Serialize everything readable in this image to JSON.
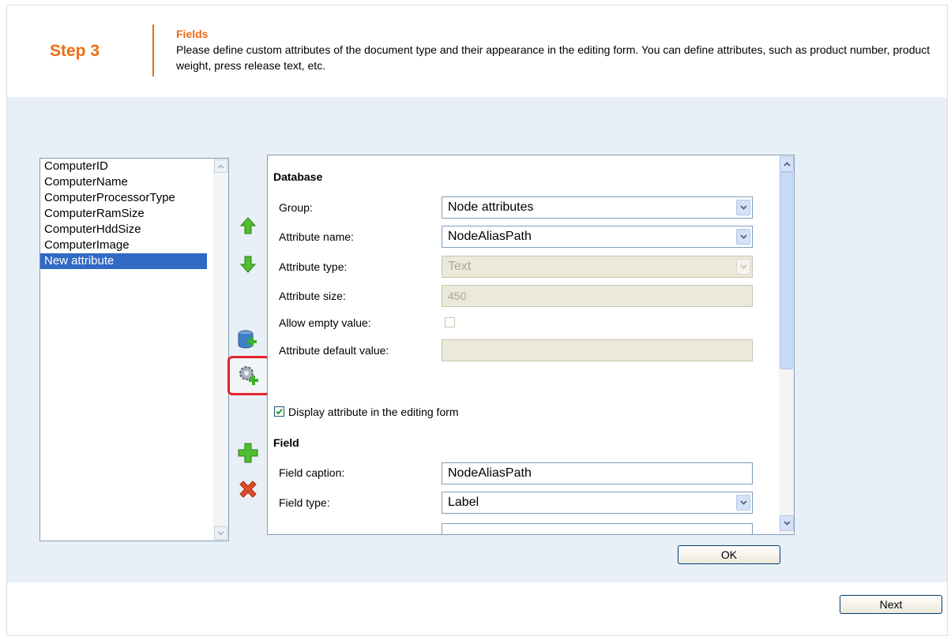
{
  "header": {
    "step": "Step 3",
    "title": "Fields",
    "description": "Please define custom attributes of the document type and their appearance in the editing form. You can define attributes, such as product number, product weight, press release text, etc."
  },
  "attributes": [
    {
      "label": "ComputerID"
    },
    {
      "label": "ComputerName"
    },
    {
      "label": "ComputerProcessorType"
    },
    {
      "label": "ComputerRamSize"
    },
    {
      "label": "ComputerHddSize"
    },
    {
      "label": "ComputerImage"
    },
    {
      "label": "New attribute"
    }
  ],
  "toolbar": {
    "icons": [
      "arrow-up-icon",
      "arrow-down-icon",
      "database-add-icon",
      "gear-add-icon",
      "plus-icon",
      "delete-icon"
    ]
  },
  "database": {
    "title": "Database",
    "group_label": "Group:",
    "group_value": "Node attributes",
    "attribute_name_label": "Attribute name:",
    "attribute_name_value": "NodeAliasPath",
    "attribute_type_label": "Attribute type:",
    "attribute_type_value": "Text",
    "attribute_size_label": "Attribute size:",
    "attribute_size_value": "450",
    "allow_empty_label": "Allow empty value:",
    "default_value_label": "Attribute default value:"
  },
  "display_in_form": "Display attribute in the editing form",
  "field": {
    "title": "Field",
    "caption_label": "Field caption:",
    "caption_value": "NodeAliasPath",
    "type_label": "Field type:",
    "type_value": "Label"
  },
  "buttons": {
    "ok": "OK",
    "next": "Next"
  },
  "colors": {
    "accent": "#ee6a14",
    "selection": "#316ac5",
    "content_bg": "#e8eff6",
    "highlight": "#e3232b"
  }
}
